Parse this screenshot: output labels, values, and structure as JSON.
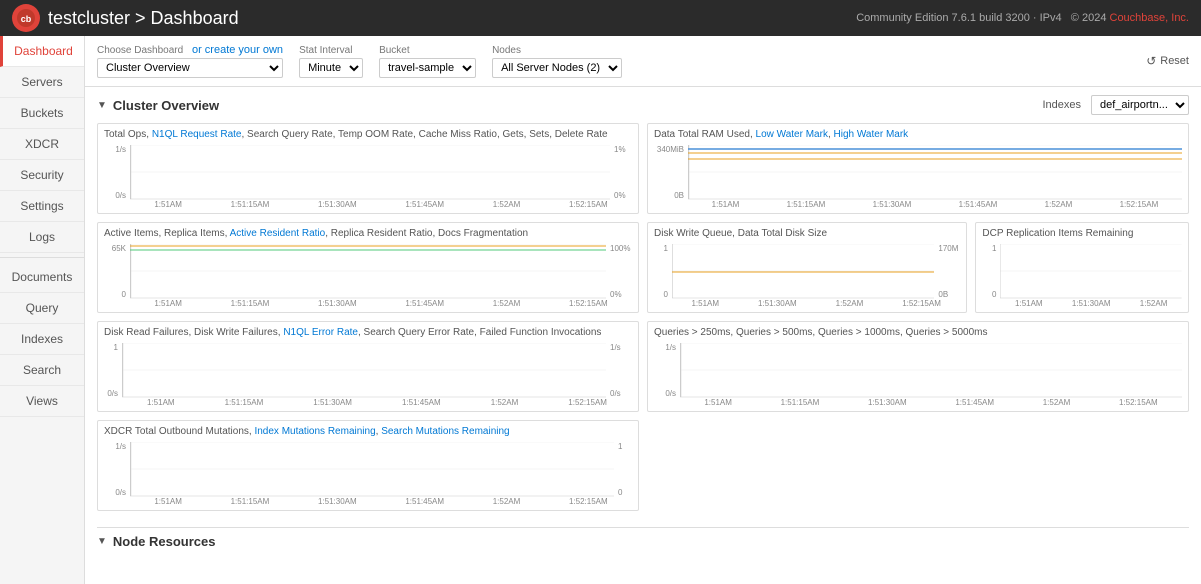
{
  "header": {
    "logo_text": "cb",
    "breadcrumb": "testcluster > Dashboard",
    "version_info": "Community Edition 7.6.1 build 3200 · IPv4  © 2024 Couchbase, Inc."
  },
  "sidebar": {
    "top_items": [
      {
        "label": "Dashboard",
        "active": true
      },
      {
        "label": "Servers",
        "active": false
      },
      {
        "label": "Buckets",
        "active": false
      },
      {
        "label": "XDCR",
        "active": false
      },
      {
        "label": "Security",
        "active": false
      },
      {
        "label": "Settings",
        "active": false
      },
      {
        "label": "Logs",
        "active": false
      }
    ],
    "bottom_items": [
      {
        "label": "Documents",
        "active": false
      },
      {
        "label": "Query",
        "active": false
      },
      {
        "label": "Indexes",
        "active": false
      },
      {
        "label": "Search",
        "active": false
      },
      {
        "label": "Views",
        "active": false
      }
    ]
  },
  "topbar": {
    "choose_dashboard_label": "Choose Dashboard",
    "or_create": "or create your own",
    "dashboard_value": "Cluster Overview",
    "stat_interval_label": "Stat Interval",
    "stat_interval_value": "Minute",
    "bucket_label": "Bucket",
    "bucket_value": "travel-sample",
    "nodes_label": "Nodes",
    "nodes_value": "All Server Nodes (2)",
    "reset_label": "Reset"
  },
  "cluster_overview": {
    "title": "Cluster Overview",
    "indexes_label": "Indexes",
    "indexes_value": "def_airportn...",
    "charts": [
      {
        "id": "total-ops",
        "title": "Total Ops, N1QL Request Rate, Search Query Rate, Temp OOM Rate, Cache Miss Ratio, Gets, Sets, Delete Rate",
        "y_max": "1/s",
        "y_min": "0/s",
        "y_right_max": "1%",
        "y_right_min": "0%",
        "x_labels": [
          "1:51AM",
          "1:51:15AM",
          "1:51:30AM",
          "1:51:45AM",
          "1:52AM",
          "1:52:15AM"
        ],
        "has_right_axis": true
      },
      {
        "id": "data-ram",
        "title": "Data Total RAM Used, Low Water Mark, High Water Mark",
        "y_max": "340MiB",
        "y_min": "0B",
        "x_labels": [
          "1:51AM",
          "1:51:15AM",
          "1:51:30AM",
          "1:51:45AM",
          "1:52AM",
          "1:52:15AM"
        ],
        "has_right_axis": false,
        "has_blue_line": true,
        "has_orange_line": true
      },
      {
        "id": "active-items",
        "title": "Active Items, Replica Items, Active Resident Ratio, Replica Resident Ratio, Docs Fragmentation",
        "y_max": "65K",
        "y_min": "0",
        "y_right_max": "100%",
        "y_right_min": "0%",
        "x_labels": [
          "1:51AM",
          "1:51:15AM",
          "1:51:30AM",
          "1:51:45AM",
          "1:52AM",
          "1:52:15AM"
        ],
        "has_right_axis": true,
        "has_orange_line": true,
        "has_green_line": true,
        "has_blue_right": true
      },
      {
        "id": "disk-write",
        "title": "Disk Write Queue, Data Total Disk Size",
        "y_max": "1",
        "y_min": "0",
        "y_right_max": "170M",
        "y_right_min": "0B",
        "x_labels": [
          "1:51AM",
          "1:51:30AM",
          "1:52AM",
          "1:52:15AM"
        ],
        "has_right_axis": true
      },
      {
        "id": "dcp-replication",
        "title": "DCP Replication Items Remaining",
        "y_max": "1",
        "y_min": "0",
        "x_labels": [
          "1:51AM",
          "1:51:30AM",
          "1:52AM"
        ],
        "has_right_axis": false
      },
      {
        "id": "disk-failures",
        "title": "Disk Read Failures, Disk Write Failures, N1QL Error Rate, Search Query Error Rate, Failed Function Invocations",
        "y_max": "1",
        "y_min": "0/s",
        "y_right_max": "1/s",
        "y_right_min": "0/s",
        "x_labels": [
          "1:51AM",
          "1:51:15AM",
          "1:51:30AM",
          "1:51:45AM",
          "1:52AM",
          "1:52:15AM"
        ],
        "has_right_axis": true
      },
      {
        "id": "queries",
        "title": "Queries > 250ms, Queries > 500ms, Queries > 1000ms, Queries > 5000ms",
        "y_max": "1/s",
        "y_min": "0/s",
        "x_labels": [
          "1:51AM",
          "1:51:15AM",
          "1:51:30AM",
          "1:51:45AM",
          "1:52AM",
          "1:52:15AM"
        ],
        "has_right_axis": false
      },
      {
        "id": "xdcr",
        "title": "XDCR Total Outbound Mutations, Index Mutations Remaining, Search Mutations Remaining",
        "y_max": "1/s",
        "y_min": "0/s",
        "y_right_max": "1",
        "y_right_min": "0",
        "x_labels": [
          "1:51AM",
          "1:51:15AM",
          "1:51:30AM",
          "1:51:45AM",
          "1:52AM",
          "1:52:15AM"
        ],
        "has_right_axis": true
      }
    ]
  },
  "node_resources": {
    "title": "Node Resources"
  }
}
